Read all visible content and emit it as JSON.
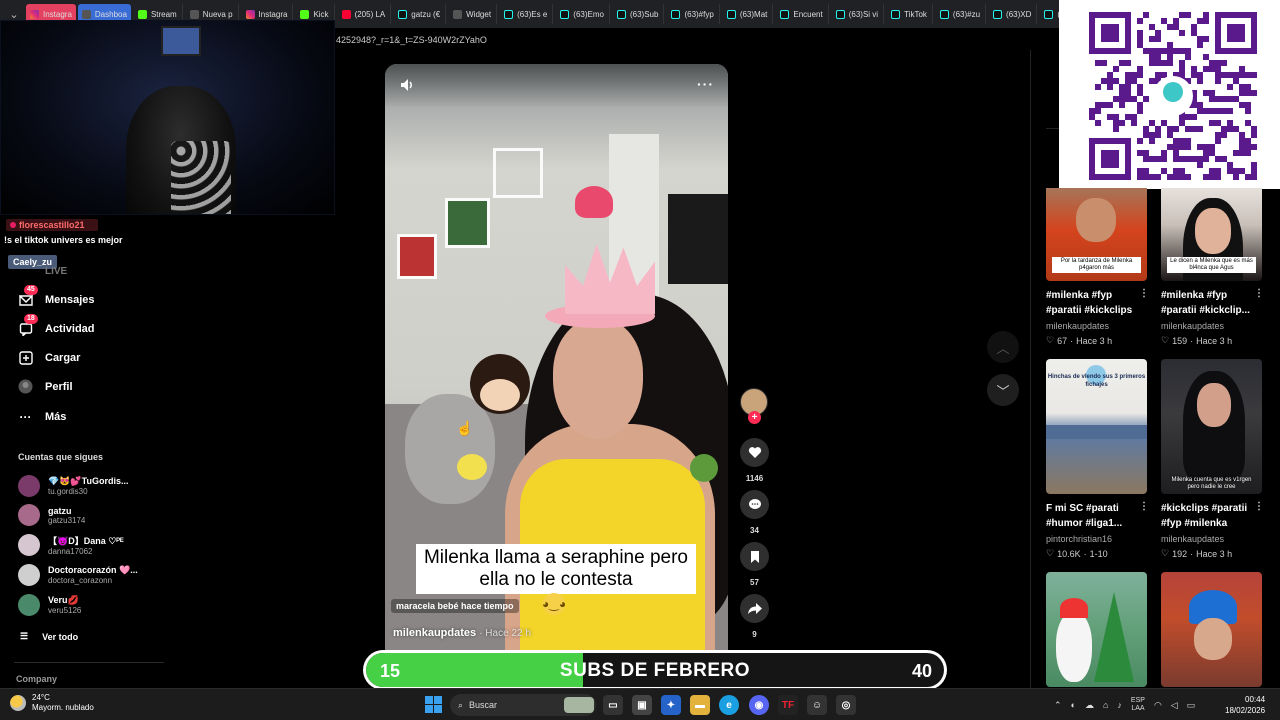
{
  "browser": {
    "tabs": [
      {
        "label": "Instagra",
        "icon": "instagram-icon",
        "style": "pink"
      },
      {
        "label": "Dashboa",
        "icon": "dashboard-icon",
        "style": "blue"
      },
      {
        "label": "Stream",
        "icon": "kick-icon"
      },
      {
        "label": "Nueva p",
        "icon": "page-icon"
      },
      {
        "label": "Instagra",
        "icon": "instagram-icon"
      },
      {
        "label": "Kick",
        "icon": "kick-icon"
      },
      {
        "label": "(205) LA",
        "icon": "youtube-icon"
      },
      {
        "label": "gatzu (€",
        "icon": "tiktok-icon"
      },
      {
        "label": "Widget",
        "icon": "widget-icon"
      },
      {
        "label": "(63)Es e",
        "icon": "tiktok-icon"
      },
      {
        "label": "(63)Emo",
        "icon": "tiktok-icon"
      },
      {
        "label": "(63)Sub",
        "icon": "tiktok-icon"
      },
      {
        "label": "(63)#fyp",
        "icon": "tiktok-icon"
      },
      {
        "label": "(63)Mat",
        "icon": "tiktok-icon"
      },
      {
        "label": "Encuent",
        "icon": "tiktok-icon"
      },
      {
        "label": "(63)Si vi",
        "icon": "tiktok-icon"
      },
      {
        "label": "TikTok",
        "icon": "tiktok-icon"
      },
      {
        "label": "(63)#zu",
        "icon": "tiktok-icon"
      },
      {
        "label": "(63)XD",
        "icon": "tiktok-icon"
      },
      {
        "label": "(63)Dra",
        "icon": "tiktok-icon"
      }
    ],
    "url_fragment": "4252948?_r=1&_t=ZS-940W2rZYahO"
  },
  "chat_overlay": {
    "user1": "florescastillo21",
    "message": "!s el tiktok univers es mejor",
    "user2": "Caely_zu"
  },
  "sidebar": {
    "live_label": "LIVE",
    "items": [
      {
        "label": "Mensajes",
        "icon": "messages-icon",
        "badge": "45"
      },
      {
        "label": "Actividad",
        "icon": "activity-icon",
        "badge": "18"
      },
      {
        "label": "Cargar",
        "icon": "upload-icon",
        "badge": ""
      },
      {
        "label": "Perfil",
        "icon": "profile-icon",
        "badge": ""
      },
      {
        "label": "Más",
        "icon": "more-icon",
        "badge": ""
      }
    ],
    "following_title": "Cuentas que sigues",
    "following": [
      {
        "name": "💎😻💕TuGordis...",
        "handle": "tu.gordis30"
      },
      {
        "name": "gatzu",
        "handle": "gatzu3174"
      },
      {
        "name": "【😈D】Dana ♡ᴾᴱ",
        "handle": "danna17062"
      },
      {
        "name": "Doctoracorazón 🩷...",
        "handle": "doctora_corazonn"
      },
      {
        "name": "Veru💋",
        "handle": "veru5126"
      }
    ],
    "see_all": "Ver todo",
    "company": "Company"
  },
  "video": {
    "caption": "Milenka llama a seraphine pero ella no le contesta",
    "sticker": "maracela bebé hace tiempo",
    "author": "milenkaupdates",
    "time": "· Hace 22 h",
    "more": "···"
  },
  "actions": {
    "likes": "1146",
    "comments": "34",
    "saves": "57",
    "shares": "9"
  },
  "recommendations": [
    {
      "title": "#milenka #fyp #paratii #kickclips",
      "author": "milenkaupdates",
      "views": "67",
      "time": "Hace 3 h",
      "thumb_text": "Por la tardanza de Milenka p4garon más"
    },
    {
      "title": "#milenka #fyp #paratii #kickclip...",
      "author": "milenkaupdates",
      "views": "159",
      "time": "Hace 3 h",
      "thumb_text": "Le dicen a Milenka que es más bl4nca que Agus"
    },
    {
      "title": "F mi SC #parati #humor #liga1...",
      "author": "pintorchristian16",
      "views": "10.6K",
      "time": "1-10",
      "thumb_text": "Hinchas de vlendo sus 3 primeros fichajes"
    },
    {
      "title": "#kickclips #paratii #fyp #milenka",
      "author": "milenkaupdates",
      "views": "192",
      "time": "Hace 3 h",
      "thumb_text": "Milenka cuenta que es v1rgen pero nadie le cree"
    },
    {
      "title": "",
      "author": "",
      "views": "",
      "time": "",
      "thumb_text": ""
    },
    {
      "title": "",
      "author": "",
      "views": "",
      "time": "",
      "thumb_text": ""
    }
  ],
  "subs_goal": {
    "current": "15",
    "goal": "40",
    "label": "SUBS DE FEBRERO",
    "progress_fraction": 0.375
  },
  "taskbar": {
    "temperature": "24°C",
    "weather": "Mayorm. nublado",
    "search_placeholder": "Buscar",
    "language_top": "ESP",
    "language_bottom": "LAA",
    "time": "00:44",
    "date": "18/02/2026"
  },
  "colors": {
    "accent": "#fe2c55",
    "progress_green": "#45d046",
    "qr_purple": "#5b1a8c"
  }
}
